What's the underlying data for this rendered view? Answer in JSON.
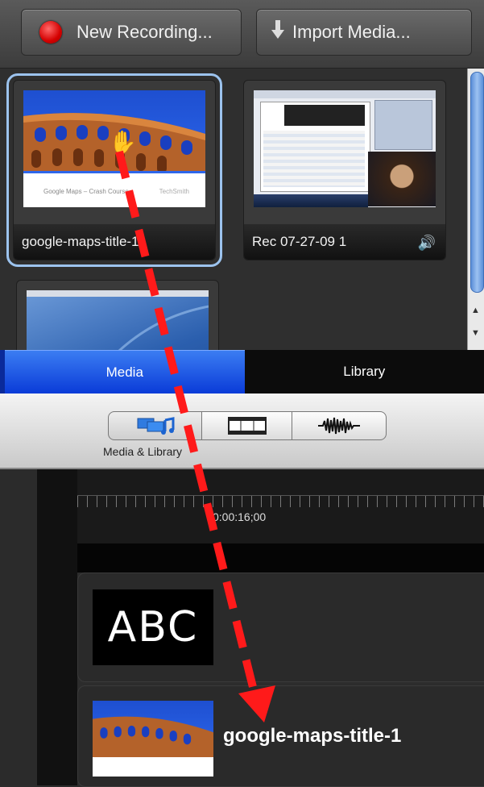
{
  "toolbar": {
    "new_recording_label": "New Recording...",
    "import_media_label": "Import Media..."
  },
  "media_grid": {
    "items": [
      {
        "caption": "google-maps-title-1",
        "selected": true
      },
      {
        "caption": "Rec 07-27-09 1",
        "has_audio": true
      },
      {
        "caption": ""
      }
    ],
    "slide_text": "Google Maps – Crash Course",
    "slide_text_right": "TechSmith"
  },
  "tabs": {
    "media_label": "Media",
    "library_label": "Library",
    "active": "Media"
  },
  "view_bar": {
    "selected_label": "Media & Library"
  },
  "timeline": {
    "timecode": "0:00:16;00"
  },
  "tracks": {
    "text_clip_label": "ABC",
    "media_clip_title": "google-maps-title-1"
  },
  "colors": {
    "accent_blue": "#2a63e8",
    "drag_arrow": "#ff1a1a",
    "selection_outline": "#9cc3ee"
  },
  "icons": [
    "record-icon",
    "import-arrow-icon",
    "hand-cursor-icon",
    "speaker-icon",
    "media-library-icon",
    "filmstrip-icon",
    "audio-waveform-icon"
  ]
}
